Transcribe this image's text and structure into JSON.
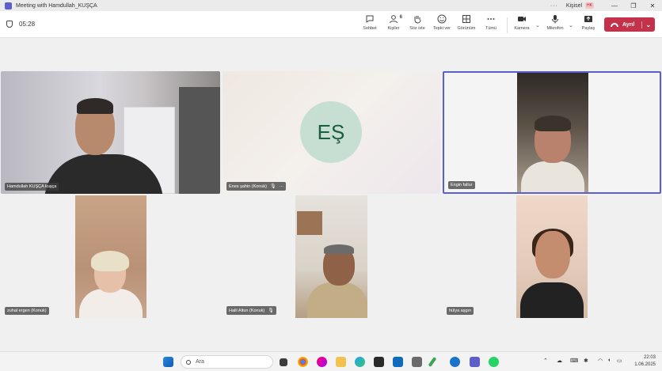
{
  "window": {
    "title": "Meeting with Hamdullah_KUŞÇA",
    "org_label": "Kişisel",
    "org_badge": "HK",
    "more": "···",
    "minimize": "—",
    "restore": "❐",
    "close": "✕"
  },
  "toolbar": {
    "timer": "05:28",
    "buttons": [
      {
        "label": "Sohbet"
      },
      {
        "label": "Kişiler",
        "count": "6"
      },
      {
        "label": "Söz iste"
      },
      {
        "label": "Tepki ver"
      },
      {
        "label": "Görünüm"
      },
      {
        "label": "Tümü"
      },
      {
        "label": "Kamera"
      },
      {
        "label": "Mikrofon"
      },
      {
        "label": "Paylaş"
      }
    ],
    "leave_label": "Ayrıl"
  },
  "participants": [
    {
      "name": "Hamdullah KUŞÇA kuşça"
    },
    {
      "name": "Enes şahin (Konuk)",
      "initials": "EŞ",
      "avatar_color": "#c7dfd2"
    },
    {
      "name": "Engin fallur"
    },
    {
      "name": "zuhal ergen (Konuk)"
    },
    {
      "name": "Halil Altun (Konuk)"
    },
    {
      "name": "hülya aşgın"
    }
  ],
  "taskbar": {
    "search_placeholder": "Ara",
    "time": "22:03",
    "date": "1.06.2025"
  },
  "colors": {
    "accent": "#5b5fc7",
    "leave": "#c4314b"
  }
}
